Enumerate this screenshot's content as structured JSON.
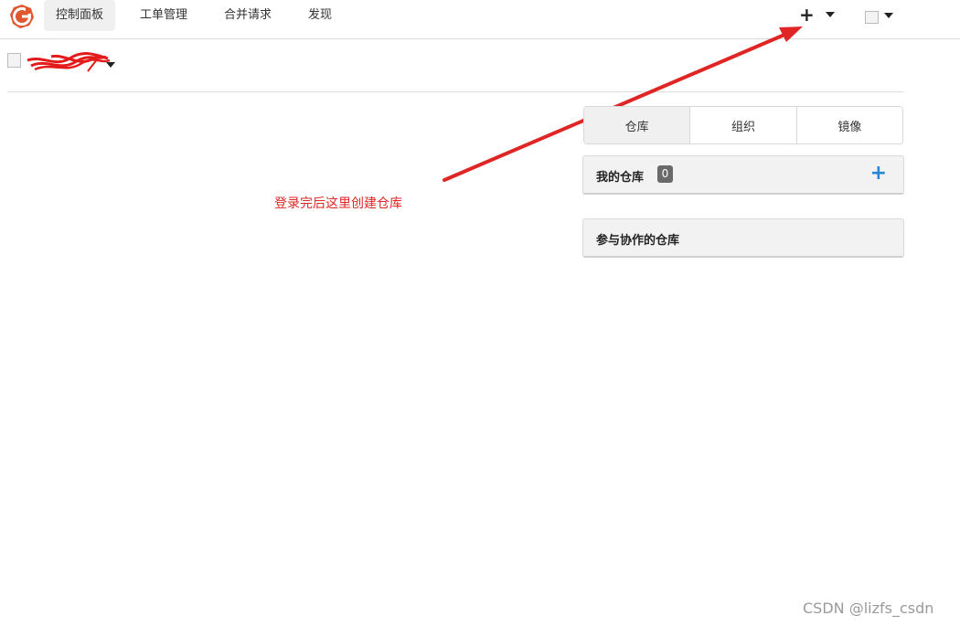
{
  "nav": {
    "items": [
      {
        "label": "控制面板",
        "active": true
      },
      {
        "label": "工单管理",
        "active": false
      },
      {
        "label": "合并请求",
        "active": false
      },
      {
        "label": "发现",
        "active": false
      }
    ],
    "create_label": "+",
    "logo_color": "#e0582f"
  },
  "annotation": {
    "text": "登录完后这里创建仓库",
    "color": "#e02525"
  },
  "tabs": [
    "仓库",
    "组织",
    "镜像"
  ],
  "my_repos": {
    "title": "我的仓库",
    "count": "0",
    "add_label": "+"
  },
  "collab_repos": {
    "title": "参与协作的仓库"
  },
  "watermark": "CSDN @lizfs_csdn"
}
